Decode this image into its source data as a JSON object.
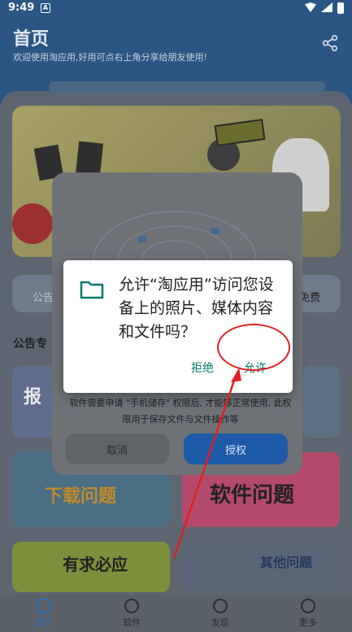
{
  "status": {
    "time": "9:49",
    "badge": "A"
  },
  "header": {
    "title": "首页",
    "subtitle": "欢迎使用淘应用,好用可点右上角分享给朋友使用!"
  },
  "notice": {
    "left": "公告",
    "right": "免费"
  },
  "section": {
    "label": "公告专"
  },
  "cards": [
    {
      "text": "报",
      "color": "#5f6e8a"
    },
    {
      "text": "软件问题",
      "color": "#b34a6b"
    },
    {
      "text": "下载问题",
      "color": "#4b6e82"
    },
    {
      "text": "有求必应",
      "color": "#7e8f3c"
    },
    {
      "text": "其他问题",
      "color": "#5a6678"
    }
  ],
  "info_dialog": {
    "text": "软件需要申请 \"手机储存\" 权限后, 才能够正常使用, 此权限用于保存文件与文件操作等",
    "cancel": "取消",
    "grant": "授权"
  },
  "system_dialog": {
    "message": "允许“淘应用”访问您设备上的照片、媒体内容和文件吗？",
    "deny": "拒绝",
    "allow": "允许",
    "icon": "folder-icon",
    "accent": "#00796b"
  },
  "nav": [
    {
      "label": "首页",
      "icon": "home-icon"
    },
    {
      "label": "软件",
      "icon": "cube-icon"
    },
    {
      "label": "发现",
      "icon": "compass-icon"
    },
    {
      "label": "更多",
      "icon": "person-icon"
    }
  ]
}
